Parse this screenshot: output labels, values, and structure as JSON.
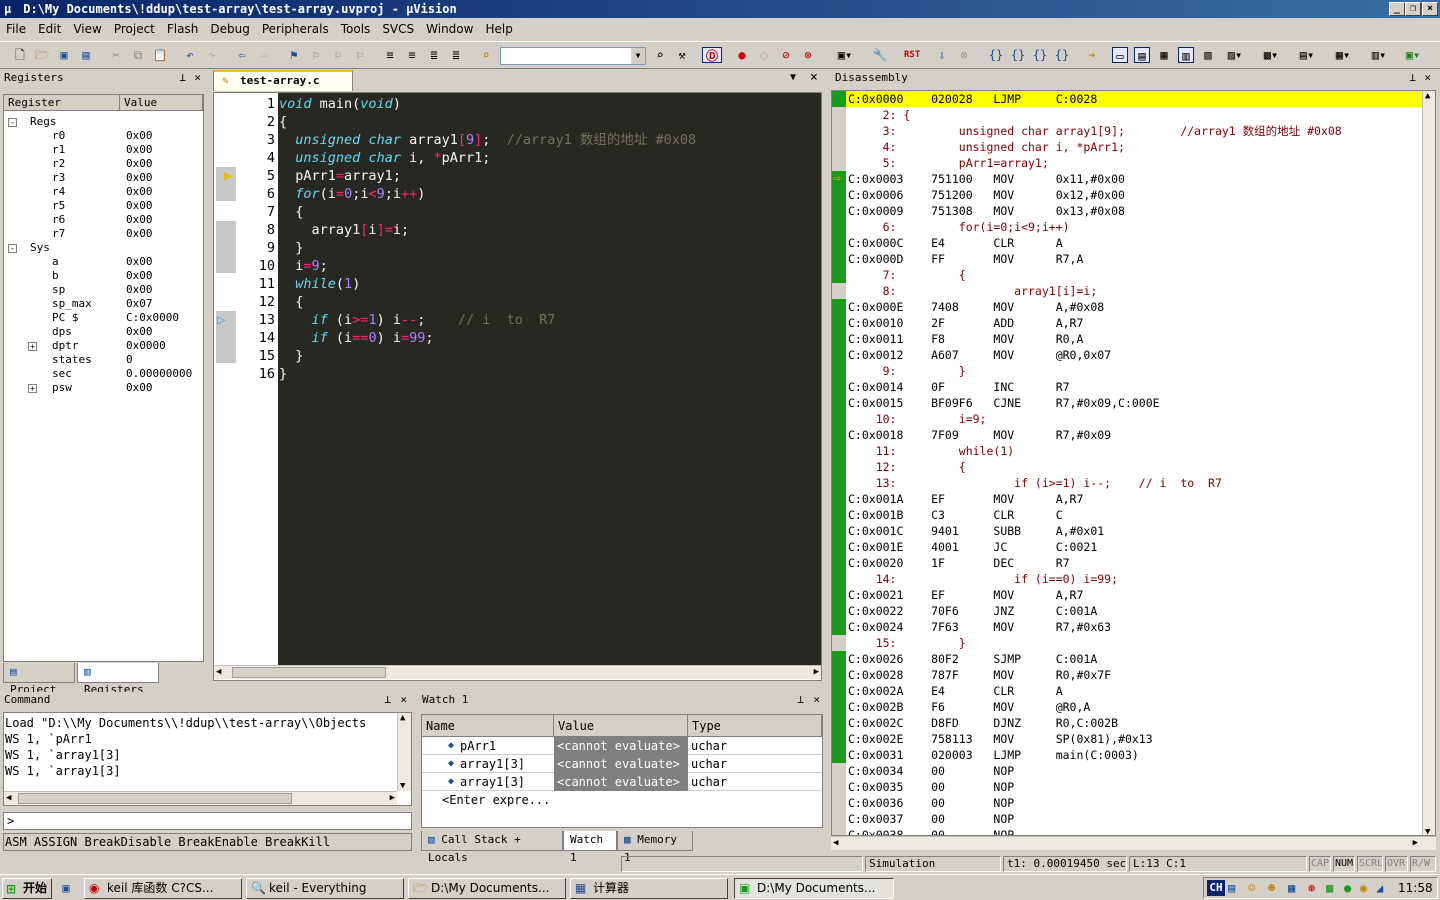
{
  "window": {
    "title": "D:\\My Documents\\!ddup\\test-array\\test-array.uvproj - µVision"
  },
  "menu": [
    "File",
    "Edit",
    "View",
    "Project",
    "Flash",
    "Debug",
    "Peripherals",
    "Tools",
    "SVCS",
    "Window",
    "Help"
  ],
  "registers": {
    "title": "Registers",
    "col_register": "Register",
    "col_value": "Value",
    "rows": [
      {
        "name": "Regs",
        "value": "",
        "indent": 1,
        "expander": "-"
      },
      {
        "name": "r0",
        "value": "0x00",
        "indent": 3
      },
      {
        "name": "r1",
        "value": "0x00",
        "indent": 3
      },
      {
        "name": "r2",
        "value": "0x00",
        "indent": 3
      },
      {
        "name": "r3",
        "value": "0x00",
        "indent": 3
      },
      {
        "name": "r4",
        "value": "0x00",
        "indent": 3
      },
      {
        "name": "r5",
        "value": "0x00",
        "indent": 3
      },
      {
        "name": "r6",
        "value": "0x00",
        "indent": 3
      },
      {
        "name": "r7",
        "value": "0x00",
        "indent": 3
      },
      {
        "name": "Sys",
        "value": "",
        "indent": 1,
        "expander": "-"
      },
      {
        "name": "a",
        "value": "0x00",
        "indent": 3
      },
      {
        "name": "b",
        "value": "0x00",
        "indent": 3
      },
      {
        "name": "sp",
        "value": "0x00",
        "indent": 3
      },
      {
        "name": "sp_max",
        "value": "0x07",
        "indent": 3
      },
      {
        "name": "PC  $",
        "value": "C:0x0000",
        "indent": 3
      },
      {
        "name": "dps",
        "value": "0x00",
        "indent": 3
      },
      {
        "name": "dptr",
        "value": "0x0000",
        "indent": 3,
        "expander": "+"
      },
      {
        "name": "states",
        "value": "0",
        "indent": 3
      },
      {
        "name": "sec",
        "value": "0.00000000",
        "indent": 3
      },
      {
        "name": "psw",
        "value": "0x00",
        "indent": 3,
        "expander": "+"
      }
    ],
    "tabs": [
      "Project",
      "Registers"
    ]
  },
  "editor": {
    "tab": "test-array.c",
    "lines": [
      "1",
      "2",
      "3",
      "4",
      "5",
      "6",
      "7",
      "8",
      "9",
      "10",
      "11",
      "12",
      "13",
      "14",
      "15",
      "16"
    ]
  },
  "disassembly": {
    "title": "Disassembly",
    "lines": [
      {
        "t": "asm",
        "text": "C:0x0000    020028   LJMP     C:0028",
        "hl": true
      },
      {
        "t": "src",
        "text": "     2: {"
      },
      {
        "t": "src",
        "text": "     3:         unsigned char array1[9];        //array1 数组的地址 #0x08"
      },
      {
        "t": "src",
        "text": "     4:         unsigned char i, *pArr1;"
      },
      {
        "t": "src",
        "text": "     5:         pArr1=array1;"
      },
      {
        "t": "asm",
        "text": "C:0x0003    751100   MOV      0x11,#0x00",
        "arrow": true
      },
      {
        "t": "asm",
        "text": "C:0x0006    751200   MOV      0x12,#0x00"
      },
      {
        "t": "asm",
        "text": "C:0x0009    751308   MOV      0x13,#0x08"
      },
      {
        "t": "src",
        "text": "     6:         for(i=0;i<9;i++)"
      },
      {
        "t": "asm",
        "text": "C:0x000C    E4       CLR      A"
      },
      {
        "t": "asm",
        "text": "C:0x000D    FF       MOV      R7,A"
      },
      {
        "t": "src",
        "text": "     7:         {"
      },
      {
        "t": "src",
        "text": "     8:                 array1[i]=i;"
      },
      {
        "t": "asm",
        "text": "C:0x000E    7408     MOV      A,#0x08"
      },
      {
        "t": "asm",
        "text": "C:0x0010    2F       ADD      A,R7"
      },
      {
        "t": "asm",
        "text": "C:0x0011    F8       MOV      R0,A"
      },
      {
        "t": "asm",
        "text": "C:0x0012    A607     MOV      @R0,0x07"
      },
      {
        "t": "src",
        "text": "     9:         }"
      },
      {
        "t": "asm",
        "text": "C:0x0014    0F       INC      R7"
      },
      {
        "t": "asm",
        "text": "C:0x0015    BF09F6   CJNE     R7,#0x09,C:000E"
      },
      {
        "t": "src",
        "text": "    10:         i=9;"
      },
      {
        "t": "asm",
        "text": "C:0x0018    7F09     MOV      R7,#0x09"
      },
      {
        "t": "src",
        "text": "    11:         while(1)"
      },
      {
        "t": "src",
        "text": "    12:         {"
      },
      {
        "t": "src",
        "text": "    13:                 if (i>=1) i--;    // i  to  R7"
      },
      {
        "t": "asm",
        "text": "C:0x001A    EF       MOV      A,R7"
      },
      {
        "t": "asm",
        "text": "C:0x001B    C3       CLR      C"
      },
      {
        "t": "asm",
        "text": "C:0x001C    9401     SUBB     A,#0x01"
      },
      {
        "t": "asm",
        "text": "C:0x001E    4001     JC       C:0021"
      },
      {
        "t": "asm",
        "text": "C:0x0020    1F       DEC      R7"
      },
      {
        "t": "src",
        "text": "    14:                 if (i==0) i=99;"
      },
      {
        "t": "asm",
        "text": "C:0x0021    EF       MOV      A,R7"
      },
      {
        "t": "asm",
        "text": "C:0x0022    70F6     JNZ      C:001A"
      },
      {
        "t": "asm",
        "text": "C:0x0024    7F63     MOV      R7,#0x63"
      },
      {
        "t": "src",
        "text": "    15:         }"
      },
      {
        "t": "asm",
        "text": "C:0x0026    80F2     SJMP     C:001A"
      },
      {
        "t": "asm",
        "text": "C:0x0028    787F     MOV      R0,#0x7F"
      },
      {
        "t": "asm",
        "text": "C:0x002A    E4       CLR      A"
      },
      {
        "t": "asm",
        "text": "C:0x002B    F6       MOV      @R0,A"
      },
      {
        "t": "asm",
        "text": "C:0x002C    D8FD     DJNZ     R0,C:002B"
      },
      {
        "t": "asm",
        "text": "C:0x002E    758113   MOV      SP(0x81),#0x13"
      },
      {
        "t": "asm",
        "text": "C:0x0031    020003   LJMP     main(C:0003)"
      },
      {
        "t": "asm",
        "text": "C:0x0034    00       NOP"
      },
      {
        "t": "asm",
        "text": "C:0x0035    00       NOP"
      },
      {
        "t": "asm",
        "text": "C:0x0036    00       NOP"
      },
      {
        "t": "asm",
        "text": "C:0x0037    00       NOP"
      },
      {
        "t": "asm",
        "text": "C:0x0038    00       NOP"
      }
    ]
  },
  "command": {
    "title": "Command",
    "lines": [
      "Load \"D:\\\\My Documents\\\\!ddup\\\\test-array\\\\Objects",
      "WS 1, `pArr1",
      "WS 1, `array1[3]",
      "WS 1, `array1[3]"
    ],
    "prompt": ">",
    "hints": "ASM ASSIGN BreakDisable BreakEnable BreakKill"
  },
  "watch": {
    "title": "Watch 1",
    "col_name": "Name",
    "col_value": "Value",
    "col_type": "Type",
    "rows": [
      {
        "name": "pArr1",
        "value": "<cannot evaluate>",
        "type": "uchar"
      },
      {
        "name": "array1[3]",
        "value": "<cannot evaluate>",
        "type": "uchar"
      },
      {
        "name": "array1[3]",
        "value": "<cannot evaluate>",
        "type": "uchar"
      }
    ],
    "enter": "<Enter expre...",
    "tabs": [
      "Call Stack + Locals",
      "Watch 1",
      "Memory 1"
    ]
  },
  "status": {
    "mode": "Simulation",
    "time": "t1: 0.00019450 sec",
    "position": "L:13 C:1",
    "flags": [
      "CAP",
      "NUM",
      "SCRL",
      "OVR",
      "R/W"
    ]
  },
  "taskbar": {
    "start": "开始",
    "tasks": [
      "keil 库函数 C?CS...",
      "keil - Everything",
      "D:\\My Documents...",
      "计算器",
      "D:\\My Documents..."
    ],
    "tray_ime": "CH",
    "clock": "11:58"
  }
}
